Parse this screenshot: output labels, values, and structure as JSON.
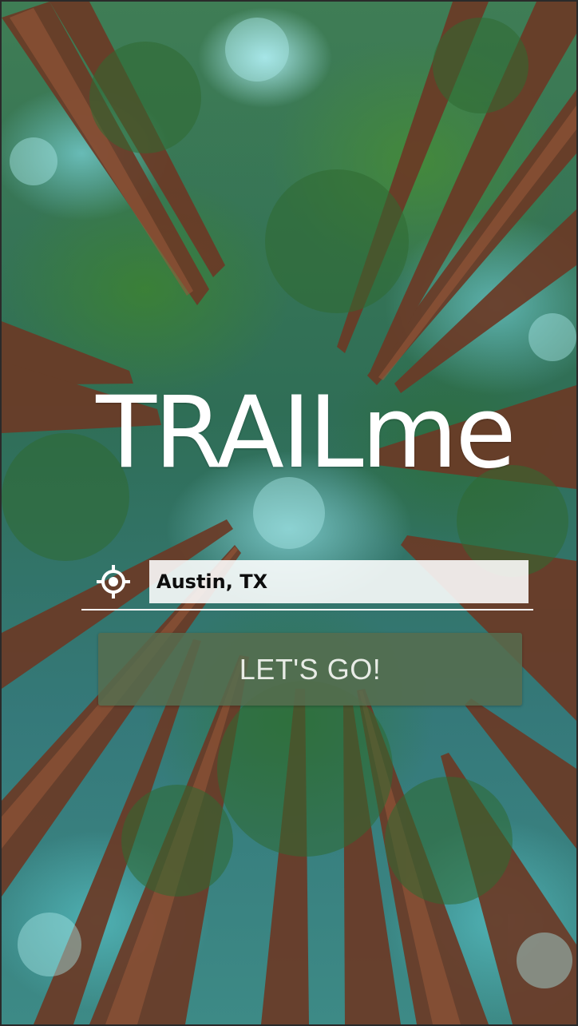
{
  "app": {
    "brand_title": "TRAILme"
  },
  "location": {
    "value": "Austin, TX",
    "locate_icon": "crosshair-location-icon"
  },
  "actions": {
    "go_label": "LET'S GO!"
  },
  "colors": {
    "title_text": "#ffffff",
    "input_background": "#ffffff",
    "input_text": "#0d0d0d",
    "underline": "#ffffff",
    "button_background": "#566c4e",
    "button_text": "#e8ece6"
  }
}
